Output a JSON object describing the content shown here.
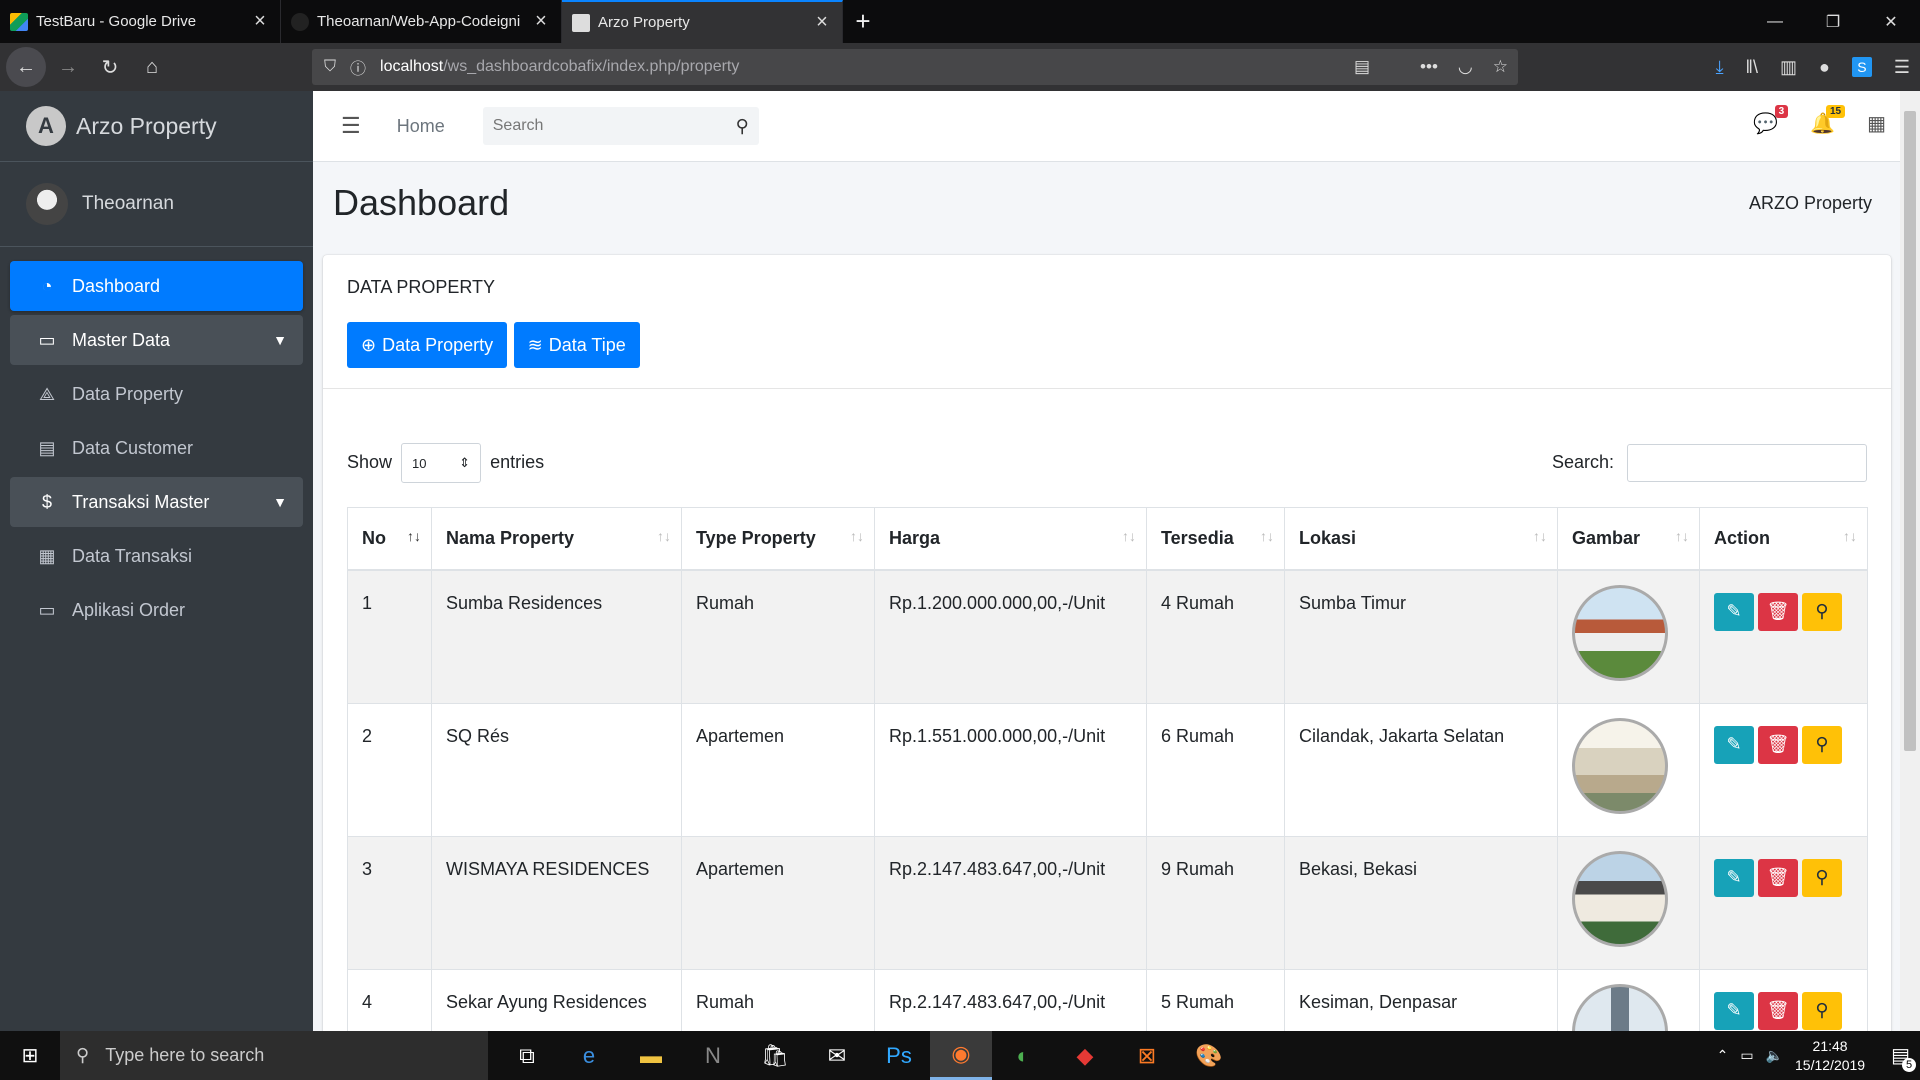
{
  "browser": {
    "tabs": [
      {
        "title": "TestBaru - Google Drive",
        "icon": "google-drive-icon",
        "active": false
      },
      {
        "title": "Theoarnan/Web-App-Codeigni",
        "icon": "github-icon",
        "active": false
      },
      {
        "title": "Arzo Property",
        "icon": "site-icon",
        "active": true
      }
    ],
    "url_host": "localhost",
    "url_path": "/ws_dashboardcobafix/index.php/property"
  },
  "sidebar": {
    "brand": "Arzo Property",
    "user": "Theoarnan",
    "items": [
      {
        "label": "Dashboard",
        "icon": "tachometer-icon",
        "state": "active"
      },
      {
        "label": "Master Data",
        "icon": "archive-icon",
        "state": "group"
      },
      {
        "label": "Data Property",
        "icon": "drafting-icon",
        "state": ""
      },
      {
        "label": "Data Customer",
        "icon": "id-card-icon",
        "state": ""
      },
      {
        "label": "Transaksi Master",
        "icon": "money-hand-icon",
        "state": "group"
      },
      {
        "label": "Data Transaksi",
        "icon": "clipboard-icon",
        "state": ""
      },
      {
        "label": "Aplikasi Order",
        "icon": "desktop-icon",
        "state": ""
      }
    ]
  },
  "topnav": {
    "home": "Home",
    "search_placeholder": "Search",
    "messages_count": "3",
    "notifications_count": "15"
  },
  "page": {
    "title": "Dashboard",
    "breadcrumb": "ARZO Property"
  },
  "card": {
    "title": "DATA PROPERTY",
    "btn_property": "Data Property",
    "btn_tipe": "Data Tipe",
    "show": "Show",
    "entries_value": "10",
    "entries": "entries",
    "search_label": "Search:"
  },
  "table": {
    "headers": [
      "No",
      "Nama Property",
      "Type Property",
      "Harga",
      "Tersedia",
      "Lokasi",
      "Gambar",
      "Action"
    ],
    "rows": [
      {
        "no": "1",
        "nama": "Sumba Residences",
        "type": "Rumah",
        "harga": "Rp.1.200.000.000,00,-/Unit",
        "tersedia": "4 Rumah",
        "lokasi": "Sumba Timur"
      },
      {
        "no": "2",
        "nama": "SQ Rés",
        "type": "Apartemen",
        "harga": "Rp.1.551.000.000,00,-/Unit",
        "tersedia": "6 Rumah",
        "lokasi": "Cilandak, Jakarta Selatan"
      },
      {
        "no": "3",
        "nama": "WISMAYA RESIDENCES",
        "type": "Apartemen",
        "harga": "Rp.2.147.483.647,00,-/Unit",
        "tersedia": "9 Rumah",
        "lokasi": "Bekasi, Bekasi"
      },
      {
        "no": "4",
        "nama": "Sekar Ayung Residences",
        "type": "Rumah",
        "harga": "Rp.2.147.483.647,00,-/Unit",
        "tersedia": "5 Rumah",
        "lokasi": "Kesiman, Denpasar"
      }
    ]
  },
  "taskbar": {
    "search_placeholder": "Type here to search",
    "time": "21:48",
    "date": "15/12/2019",
    "notif_count": "5"
  }
}
